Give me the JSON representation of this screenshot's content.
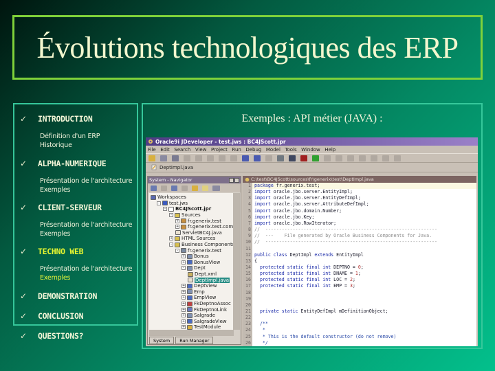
{
  "slide_title": "Évolutions technologiques des ERP",
  "menu": [
    {
      "label": "INTRODUCTION",
      "highlight": false,
      "subitems": [
        {
          "text": "Définition d'un ERP",
          "highlight": false
        },
        {
          "text": "Historique",
          "highlight": false
        }
      ]
    },
    {
      "label": "ALPHA-NUMERIQUE",
      "highlight": false,
      "subitems": [
        {
          "text": "Présentation de l'architecture",
          "highlight": false
        },
        {
          "text": "Exemples",
          "highlight": false
        }
      ]
    },
    {
      "label": "CLIENT-SERVEUR",
      "highlight": false,
      "subitems": [
        {
          "text": "Présentation de l'architecture",
          "highlight": false
        },
        {
          "text": "Exemples",
          "highlight": false
        }
      ]
    },
    {
      "label": "TECHNO WEB",
      "highlight": true,
      "subitems": [
        {
          "text": "Présentation de l'architecture",
          "highlight": false
        },
        {
          "text": "Exemples",
          "highlight": true
        }
      ]
    },
    {
      "label": "DEMONSTRATION",
      "highlight": false,
      "subitems": []
    },
    {
      "label": "CONCLUSION",
      "highlight": false,
      "subitems": []
    },
    {
      "label": "QUESTIONS?",
      "highlight": false,
      "subitems": []
    }
  ],
  "check_glyph": "✓",
  "right_title": "Exemples : API métier (JAVA) :",
  "ide": {
    "window_title": "Oracle9i JDeveloper - test.jws : BC4JScott.jpr",
    "menu": [
      "File",
      "Edit",
      "Search",
      "View",
      "Project",
      "Run",
      "Debug",
      "Model",
      "Tools",
      "Window",
      "Help"
    ],
    "open_file_tab": "DeptImpl.java",
    "navigator": {
      "title": "System - Navigator",
      "tree": [
        {
          "label": "Workspaces",
          "depth": 0,
          "toggle": "",
          "icon": "workspaces-icon",
          "color": "#5a6ab0",
          "selected": false,
          "bold": false
        },
        {
          "label": "test.jws",
          "depth": 1,
          "toggle": "-",
          "icon": "workspace-icon",
          "color": "#3a5ac0",
          "selected": false,
          "bold": false
        },
        {
          "label": "BC4JScott.jpr",
          "depth": 2,
          "toggle": "-",
          "icon": "project-icon",
          "color": "#ffffff",
          "selected": false,
          "bold": true
        },
        {
          "label": "Sources",
          "depth": 3,
          "toggle": "-",
          "icon": "folder-icon",
          "color": "#d8c050",
          "selected": false,
          "bold": false
        },
        {
          "label": "fr.generix.test",
          "depth": 4,
          "toggle": "+",
          "icon": "package-icon",
          "color": "#c89040",
          "selected": false,
          "bold": false
        },
        {
          "label": "fr.generix.test.common",
          "depth": 4,
          "toggle": "+",
          "icon": "package-icon",
          "color": "#c89040",
          "selected": false,
          "bold": false
        },
        {
          "label": "ServletBC4J.java",
          "depth": 4,
          "toggle": "",
          "icon": "java-file-icon",
          "color": "#e8e0d0",
          "selected": false,
          "bold": false
        },
        {
          "label": "HTML Sources",
          "depth": 3,
          "toggle": "+",
          "icon": "folder-icon",
          "color": "#d8c050",
          "selected": false,
          "bold": false
        },
        {
          "label": "Business Components",
          "depth": 3,
          "toggle": "-",
          "icon": "folder-icon",
          "color": "#d8c050",
          "selected": false,
          "bold": false
        },
        {
          "label": "fr.generix.test",
          "depth": 4,
          "toggle": "-",
          "icon": "bc-package-icon",
          "color": "#7a8aa0",
          "selected": false,
          "bold": false
        },
        {
          "label": "Bonus",
          "depth": 5,
          "toggle": "+",
          "icon": "entity-icon",
          "color": "#8090b0",
          "selected": false,
          "bold": false
        },
        {
          "label": "BonusView",
          "depth": 5,
          "toggle": "+",
          "icon": "view-icon",
          "color": "#4a6ac0",
          "selected": false,
          "bold": false
        },
        {
          "label": "Dept",
          "depth": 5,
          "toggle": "-",
          "icon": "entity-icon",
          "color": "#8090b0",
          "selected": false,
          "bold": false
        },
        {
          "label": "Dept.xml",
          "depth": 6,
          "toggle": "",
          "icon": "xml-file-icon",
          "color": "#c8b060",
          "selected": false,
          "bold": false
        },
        {
          "label": "DeptImpl.java",
          "depth": 6,
          "toggle": "",
          "icon": "java-file-icon",
          "color": "#e8e0d0",
          "selected": true,
          "bold": false
        },
        {
          "label": "DeptView",
          "depth": 5,
          "toggle": "+",
          "icon": "view-icon",
          "color": "#4a6ac0",
          "selected": false,
          "bold": false
        },
        {
          "label": "Emp",
          "depth": 5,
          "toggle": "+",
          "icon": "entity-icon",
          "color": "#8090b0",
          "selected": false,
          "bold": false
        },
        {
          "label": "EmpView",
          "depth": 5,
          "toggle": "+",
          "icon": "view-icon",
          "color": "#4a6ac0",
          "selected": false,
          "bold": false
        },
        {
          "label": "FkDeptnoAssoc",
          "depth": 5,
          "toggle": "+",
          "icon": "association-icon",
          "color": "#c04040",
          "selected": false,
          "bold": false
        },
        {
          "label": "FkDeptnoLink",
          "depth": 5,
          "toggle": "+",
          "icon": "link-icon",
          "color": "#6a7ac0",
          "selected": false,
          "bold": false
        },
        {
          "label": "Salgrade",
          "depth": 5,
          "toggle": "+",
          "icon": "entity-icon",
          "color": "#8090b0",
          "selected": false,
          "bold": false
        },
        {
          "label": "SalgradeView",
          "depth": 5,
          "toggle": "+",
          "icon": "view-icon",
          "color": "#4a6ac0",
          "selected": false,
          "bold": false
        },
        {
          "label": "TestModule",
          "depth": 5,
          "toggle": "+",
          "icon": "module-icon",
          "color": "#d8b040",
          "selected": false,
          "bold": false
        }
      ],
      "tabs": [
        "System",
        "Run Manager"
      ]
    },
    "editor": {
      "path": "C:\\test\\BC4JScott\\sources\\fr\\generix\\test\\DeptImpl.java",
      "lines": [
        {
          "n": "1",
          "html": "<span class=\"kw\">package</span> fr.generix.test;"
        },
        {
          "n": "2",
          "html": "<span class=\"kw\">import</span> oracle.jbo.server.EntityImpl;"
        },
        {
          "n": "3",
          "html": "<span class=\"kw\">import</span> oracle.jbo.server.EntityDefImpl;"
        },
        {
          "n": "4",
          "html": "<span class=\"kw\">import</span> oracle.jbo.server.AttributeDefImpl;"
        },
        {
          "n": "5",
          "html": "<span class=\"kw\">import</span> oracle.jbo.domain.Number;"
        },
        {
          "n": "6",
          "html": "<span class=\"kw\">import</span> oracle.jbo.Key;"
        },
        {
          "n": "7",
          "html": "<span class=\"kw\">import</span> oracle.jbo.RowIterator;"
        },
        {
          "n": "8",
          "html": "<span class=\"cm\">//  ---------------------------------------------------------------</span>"
        },
        {
          "n": "9",
          "html": "<span class=\"cm\">//  ---    File generated by Oracle Business Components for Java.</span>"
        },
        {
          "n": "10",
          "html": "<span class=\"cm\">//  ---------------------------------------------------------------</span>"
        },
        {
          "n": "11",
          "html": ""
        },
        {
          "n": "12",
          "html": "<span class=\"kw\">public class</span> DeptImpl <span class=\"kw\">extends</span> EntityImpl"
        },
        {
          "n": "13",
          "html": "{"
        },
        {
          "n": "14",
          "html": "  <span class=\"kw\">protected static final int</span> DEPTNO = <span class=\"num\">0</span>;"
        },
        {
          "n": "15",
          "html": "  <span class=\"kw\">protected static final int</span> DNAME = <span class=\"num\">1</span>;"
        },
        {
          "n": "16",
          "html": "  <span class=\"kw\">protected static final int</span> LOC = <span class=\"num\">2</span>;"
        },
        {
          "n": "17",
          "html": "  <span class=\"kw\">protected static final int</span> EMP = <span class=\"num\">3</span>;"
        },
        {
          "n": "18",
          "html": ""
        },
        {
          "n": "19",
          "html": ""
        },
        {
          "n": "20",
          "html": ""
        },
        {
          "n": "21",
          "html": "  <span class=\"kw\">private static</span> EntityDefImpl mDefinitionObject;"
        },
        {
          "n": "22",
          "html": ""
        },
        {
          "n": "23",
          "html": "  <span class=\"jd\">/**</span>"
        },
        {
          "n": "24",
          "html": "  <span class=\"jd\"> *</span>"
        },
        {
          "n": "25",
          "html": "  <span class=\"jd\"> * This is the default constructor (do not remove)</span>"
        },
        {
          "n": "26",
          "html": "  <span class=\"jd\"> */</span>"
        }
      ]
    },
    "toolbar_icon_colors": [
      "#d8b040",
      "#8a8aa0",
      "#7a7a90",
      "#b0a8a0",
      "#b0a8a0",
      "#b0a8a0",
      "#b0a8a0",
      "#b0a8a0",
      "#4a5ab0",
      "#4a5ab0",
      "#b0a8a0",
      "#707880",
      "#404860",
      "#a02020",
      "#30a030",
      "#b0a8a0",
      "#b0a8a0",
      "#b0a8a0",
      "#b0a8a0",
      "#b0a8a0",
      "#b0a8a0",
      "#b0a8a0"
    ]
  }
}
